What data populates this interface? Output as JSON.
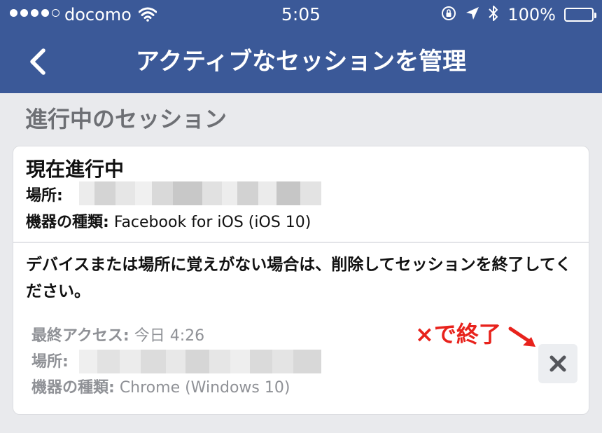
{
  "status_bar": {
    "carrier": "docomo",
    "time": "5:05",
    "battery": "100%",
    "signal_bars": 4,
    "signal_max": 5
  },
  "nav": {
    "title": "アクティブなセッションを管理",
    "back_icon": "chevron-left-icon"
  },
  "section": {
    "title": "進行中のセッション"
  },
  "current_session": {
    "heading": "現在進行中",
    "location_label": "場所:",
    "location_value": "",
    "device_label": "機器の種類:",
    "device_value": "Facebook for iOS (iOS 10)"
  },
  "notice": "デバイスまたは場所に覚えがない場合は、削除してセッションを終了してください。",
  "other_session": {
    "last_access_label": "最終アクセス:",
    "last_access_value": "今日 4:26",
    "location_label": "場所:",
    "location_value": "",
    "device_label": "機器の種類:",
    "device_value": "Chrome (Windows 10)",
    "close_icon": "close-icon"
  },
  "annotation": {
    "text": "×で終了",
    "color": "#e8221c"
  },
  "colors": {
    "header": "#3b5998",
    "background": "#e9eaed"
  }
}
